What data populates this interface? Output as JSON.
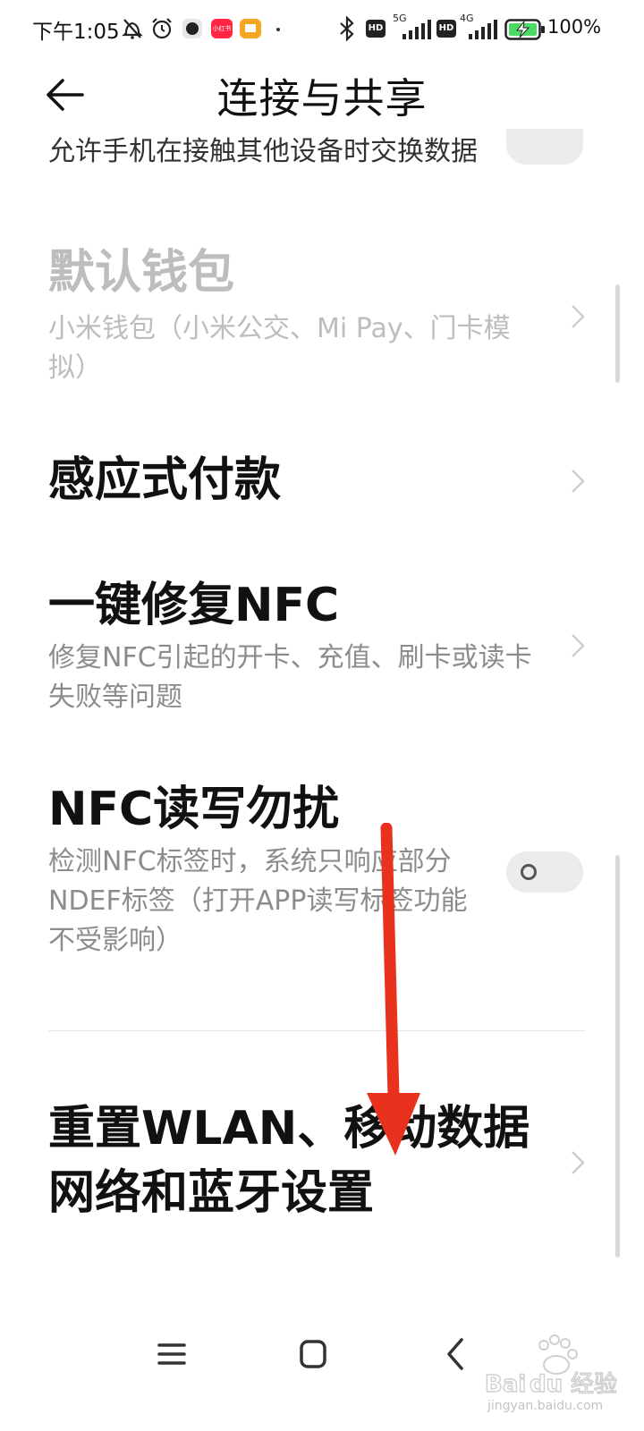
{
  "status_bar": {
    "time": "下午1:05",
    "icons": [
      "mute-bell-icon",
      "alarm-icon",
      "app-circle-icon",
      "xiaohongshu-icon",
      "notes-app-icon",
      "dot-icon",
      "bluetooth-icon",
      "hd-icon",
      "signal-5g-icon",
      "hd-icon",
      "signal-4g-icon",
      "battery-charging-icon"
    ],
    "badge_app": "小红书",
    "hd": "HD",
    "sim1": "5G",
    "sim2": "4G",
    "battery": "100%"
  },
  "header": {
    "title": "连接与共享",
    "back_icon": "back-arrow-icon"
  },
  "settings": {
    "nfc_exchange": {
      "desc": "允许手机在接触其他设备时交换数据",
      "enabled": false
    },
    "default_wallet": {
      "title": "默认钱包",
      "desc": "小米钱包（小米公交、Mi Pay、门卡模拟）",
      "disabled": true
    },
    "contactless_pay": {
      "title": "感应式付款"
    },
    "fix_nfc": {
      "title": "一键修复NFC",
      "desc": "修复NFC引起的开卡、充值、刷卡或读卡失败等问题"
    },
    "nfc_dnd": {
      "title": "NFC读写勿扰",
      "desc": "检测NFC标签时，系统只响应部分NDEF标签（打开APP读写标签功能不受影响）",
      "enabled": false
    },
    "reset_network": {
      "title": "重置WLAN、移动数据网络和蓝牙设置"
    }
  },
  "nav_bar": {
    "icons": [
      "menu-icon",
      "home-icon",
      "back-icon"
    ]
  },
  "annotation": {
    "arrow_color": "#e8321e",
    "direction": "down"
  },
  "watermark": {
    "text": "jingyan.baidu.com"
  },
  "colors": {
    "primary_text": "#111111",
    "secondary_text": "#8c8c8c",
    "disabled_text": "#bdbdbd",
    "toggle_off": "#ebebeb"
  }
}
